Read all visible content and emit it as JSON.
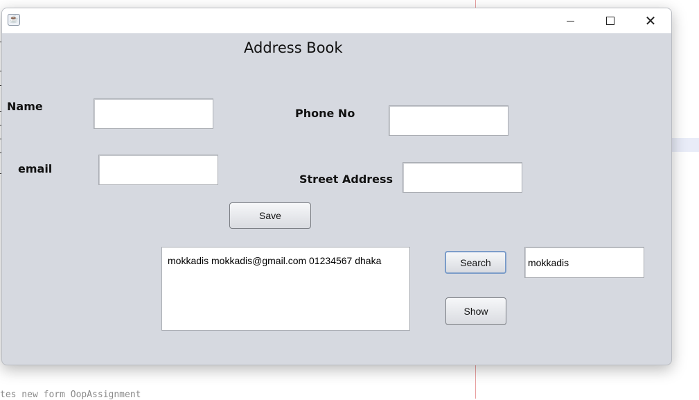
{
  "window": {
    "title": "",
    "icon": "java-coffee-cup-icon"
  },
  "form": {
    "heading": "Address Book",
    "name_label": "Name",
    "name_value": "",
    "phone_label": "Phone No",
    "phone_value": "",
    "email_label": "email",
    "email_value": "",
    "street_label": "Street Address",
    "street_value": "",
    "save_label": "Save",
    "search_label": "Search",
    "show_label": "Show",
    "search_value": "mokkadis",
    "results_text": "mokkadis mokkadis@gmail.com 01234567 dhaka"
  },
  "background": {
    "code_snippet": "tes new form OopAssignment"
  },
  "colors": {
    "window_bg": "#d6d9e0",
    "focus_border": "#7b9cc9"
  }
}
